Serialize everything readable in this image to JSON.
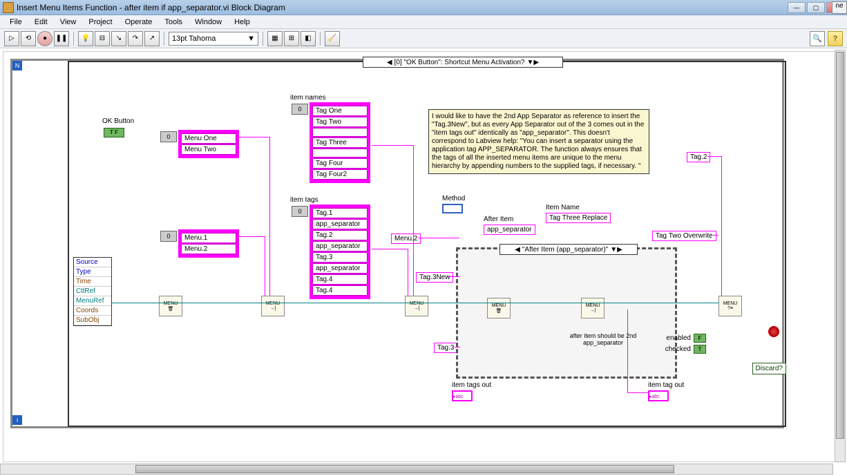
{
  "window": {
    "title": "Insert Menu Items Function - after item if app_separator.vi Block Diagram",
    "extra_tab": "ne"
  },
  "menubar": [
    "File",
    "Edit",
    "View",
    "Project",
    "Operate",
    "Tools",
    "Window",
    "Help"
  ],
  "toolbar": {
    "font": "13pt Tahoma"
  },
  "case_structure": {
    "label": "[0] \"OK Button\": Shortcut Menu Activation?"
  },
  "event_cluster": [
    "Source",
    "Type",
    "Time",
    "CtlRef",
    "MenuRef",
    "Coords",
    "SubObj"
  ],
  "ok_button": {
    "label": "OK Button",
    "value": "T F"
  },
  "arrays": {
    "menu_names": {
      "items": [
        "Menu One",
        "Menu Two"
      ]
    },
    "menu_tags": {
      "items": [
        "Menu.1",
        "Menu.2"
      ]
    },
    "item_names": {
      "label": "item names",
      "items": [
        "Tag One",
        "Tag Two",
        "",
        "Tag Three",
        "",
        "Tag Four",
        "Tag Four2"
      ]
    },
    "item_tags": {
      "label": "item tags",
      "items": [
        "Tag.1",
        "app_separator",
        "Tag.2",
        "app_separator",
        "Tag.3",
        "app_separator",
        "Tag.4",
        "Tag.4"
      ]
    }
  },
  "constants": {
    "menu2": "Menu.2",
    "tag3new": "Tag.3New",
    "tag3": "Tag.3",
    "after_item_label": "After Item",
    "after_item_val": "app_separator",
    "item_name_label": "Item Name",
    "item_name_val": "Tag Three Replace",
    "tag_two_overwrite": "Tag Two Overwrite",
    "tag2": "Tag.2",
    "method_label": "Method"
  },
  "sub_case": {
    "label": "\"After Item (app_separator)\"",
    "comment": "after item should be\n2nd app_separator"
  },
  "note": "I would like to have the 2nd App Separator as reference to insert the \"Tag.3New\", but as every App Separator out of the 3 comes out in the \"item tags out\" identically as \"app_separator\". This doesn't correspond to Labview help: \"You can insert a separator using the application tag APP_SEPARATOR. The function always ensures that the tags of all the inserted menu items are unique to the menu hierarchy by appending numbers to the supplied tags, if necessary. \"",
  "outputs": {
    "item_tags_out": "item tags out",
    "item_tag_out": "item tag out",
    "enabled": "enabled",
    "checked": "checked",
    "discard": "Discard?"
  },
  "bool_values": {
    "enabled": "F",
    "checked": "T"
  },
  "node_label": "MENU"
}
